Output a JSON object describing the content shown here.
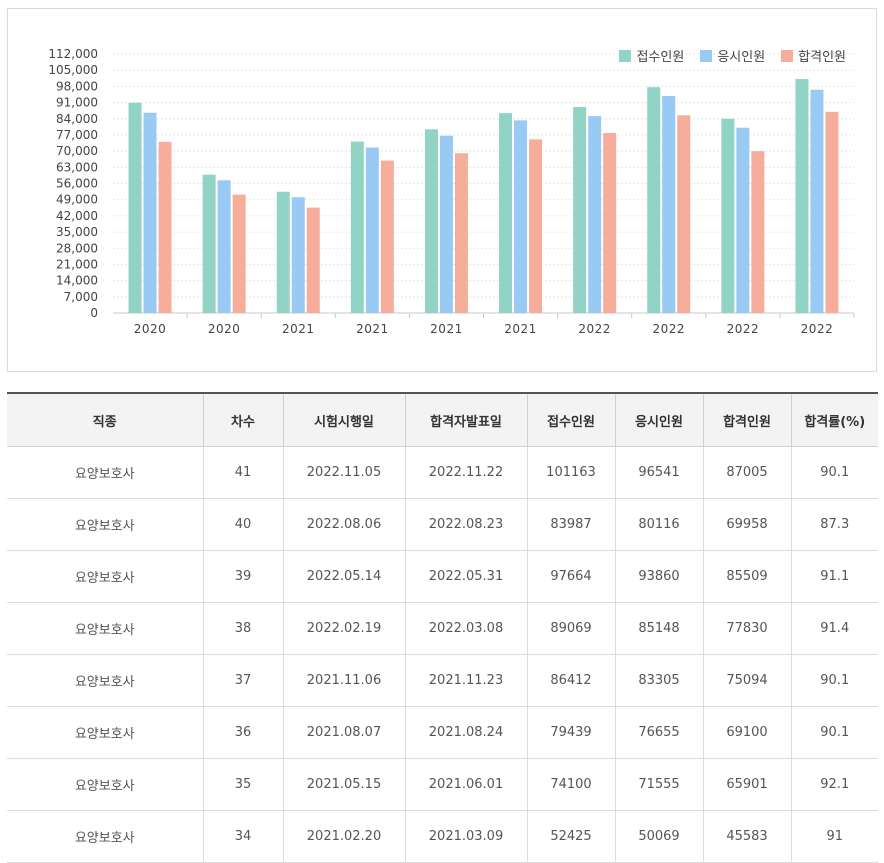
{
  "chart_data": {
    "type": "bar",
    "categories": [
      "2020",
      "2020",
      "2021",
      "2021",
      "2021",
      "2021",
      "2022",
      "2022",
      "2022",
      "2022"
    ],
    "series": [
      {
        "name": "접수인원",
        "color": "#91d3c5",
        "values": [
          90900,
          59800,
          52425,
          74100,
          79439,
          86412,
          89069,
          97664,
          83987,
          101163
        ]
      },
      {
        "name": "응시인원",
        "color": "#99caf4",
        "values": [
          86600,
          57400,
          50069,
          71555,
          76655,
          83305,
          85148,
          93860,
          80116,
          96541
        ]
      },
      {
        "name": "합격인원",
        "color": "#f6ad9b",
        "values": [
          74000,
          51200,
          45583,
          65901,
          69100,
          75094,
          77830,
          85509,
          69958,
          87005
        ]
      }
    ],
    "yticks": [
      "0",
      "7,000",
      "14,000",
      "21,000",
      "28,000",
      "35,000",
      "42,000",
      "49,000",
      "56,000",
      "63,000",
      "70,000",
      "77,000",
      "84,000",
      "91,000",
      "98,000",
      "105,000",
      "112,000"
    ],
    "ylim": [
      0,
      112000
    ],
    "legend_position": "top-right",
    "grid": true
  },
  "table": {
    "headers": [
      "직종",
      "차수",
      "시험시행일",
      "합격자발표일",
      "접수인원",
      "응시인원",
      "합격인원",
      "합격률(%)"
    ],
    "rows": [
      [
        "요양보호사",
        "41",
        "2022.11.05",
        "2022.11.22",
        "101163",
        "96541",
        "87005",
        "90.1"
      ],
      [
        "요양보호사",
        "40",
        "2022.08.06",
        "2022.08.23",
        "83987",
        "80116",
        "69958",
        "87.3"
      ],
      [
        "요양보호사",
        "39",
        "2022.05.14",
        "2022.05.31",
        "97664",
        "93860",
        "85509",
        "91.1"
      ],
      [
        "요양보호사",
        "38",
        "2022.02.19",
        "2022.03.08",
        "89069",
        "85148",
        "77830",
        "91.4"
      ],
      [
        "요양보호사",
        "37",
        "2021.11.06",
        "2021.11.23",
        "86412",
        "83305",
        "75094",
        "90.1"
      ],
      [
        "요양보호사",
        "36",
        "2021.08.07",
        "2021.08.24",
        "79439",
        "76655",
        "69100",
        "90.1"
      ],
      [
        "요양보호사",
        "35",
        "2021.05.15",
        "2021.06.01",
        "74100",
        "71555",
        "65901",
        "92.1"
      ],
      [
        "요양보호사",
        "34",
        "2021.02.20",
        "2021.03.09",
        "52425",
        "50069",
        "45583",
        "91"
      ]
    ]
  }
}
